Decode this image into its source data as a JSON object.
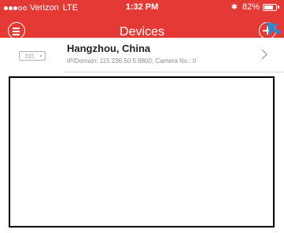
{
  "status_bar": {
    "carrier": "Verizon",
    "network": "LTE",
    "time": "1:32 PM",
    "battery_percent": "82%",
    "battery_level": 0.82,
    "signal_bars_filled": 3,
    "signal_bars_total": 5
  },
  "nav": {
    "title": "Devices",
    "menu_icon": "menu-icon",
    "add_icon": "plus-circle-icon"
  },
  "devices": [
    {
      "name": "Hangzhou, China",
      "details": "IP/Domain: 115.236.50.5:8800, Camera No.: 0"
    }
  ],
  "colors": {
    "accent": "#e53935",
    "pointer": "#3b83c7"
  }
}
